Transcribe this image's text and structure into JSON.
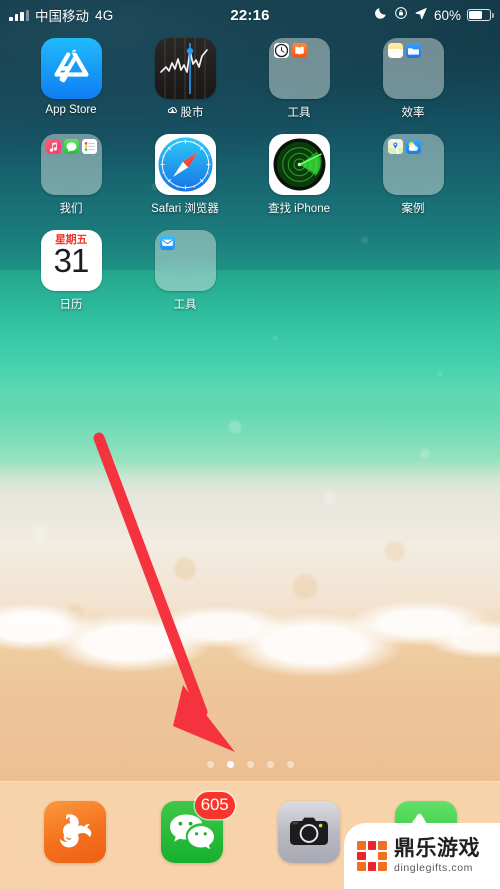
{
  "status_bar": {
    "carrier": "中国移动",
    "network_type": "4G",
    "time": "22:16",
    "battery_percent": "60%",
    "icons": [
      "signal-bars-icon",
      "moon-dnd-icon",
      "rotation-lock-icon",
      "location-arrow-icon",
      "battery-icon"
    ]
  },
  "home_screen": {
    "rows": [
      {
        "apps": [
          {
            "name": "App Store",
            "label": "App Store",
            "type": "app",
            "icon": "app-store-icon",
            "color": "#0f7ef4"
          },
          {
            "name": "Stocks",
            "label": "股市",
            "type": "app",
            "icon": "stocks-icon",
            "color": "#1a1817",
            "downloading": true
          },
          {
            "name": "Tools Folder",
            "label": "工具",
            "type": "folder",
            "mini_apps": [
              "clock-icon",
              "books-icon"
            ]
          },
          {
            "name": "Productivity Folder",
            "label": "效率",
            "type": "folder",
            "mini_apps": [
              "notes-icon",
              "files-icon"
            ]
          }
        ]
      },
      {
        "apps": [
          {
            "name": "Us Folder",
            "label": "我们",
            "type": "folder",
            "mini_apps": [
              "music-icon",
              "messages-icon",
              "reminders-icon"
            ]
          },
          {
            "name": "Safari",
            "label": "Safari 浏览器",
            "type": "app",
            "icon": "safari-icon",
            "color": "#1c8ef0"
          },
          {
            "name": "Find My iPhone",
            "label": "查找 iPhone",
            "type": "app",
            "icon": "find-my-iphone-icon",
            "color": "#17a81a"
          },
          {
            "name": "Cases Folder",
            "label": "案例",
            "type": "folder",
            "mini_apps": [
              "maps-icon",
              "weather-icon"
            ]
          }
        ]
      },
      {
        "apps": [
          {
            "name": "Calendar",
            "label": "日历",
            "type": "app",
            "icon": "calendar-icon",
            "weekday": "星期五",
            "day": "31",
            "color": "#f2392c"
          },
          {
            "name": "Tools Folder 2",
            "label": "工具",
            "type": "folder",
            "mini_apps": [
              "mail-icon"
            ]
          }
        ]
      }
    ]
  },
  "page_dots": {
    "count": 5,
    "active_index": 1
  },
  "dock": {
    "apps": [
      {
        "name": "UC Browser",
        "label": "UC浏览器",
        "icon": "uc-browser-icon",
        "color": "#f4701d",
        "badge": ""
      },
      {
        "name": "WeChat",
        "label": "微信",
        "icon": "wechat-icon",
        "color": "#17b02c",
        "badge": "605"
      },
      {
        "name": "Camera",
        "label": "相机",
        "icon": "camera-icon",
        "color": "#b9b9c2",
        "badge": ""
      },
      {
        "name": "Phone",
        "label": "电话",
        "icon": "phone-icon",
        "color": "#23c131",
        "badge": ""
      }
    ]
  },
  "annotation": {
    "type": "red-arrow",
    "color": "#f5333f",
    "points_to": "page-dots"
  },
  "watermark": {
    "title": "鼎乐游戏",
    "url": "dinglegifts.com"
  }
}
